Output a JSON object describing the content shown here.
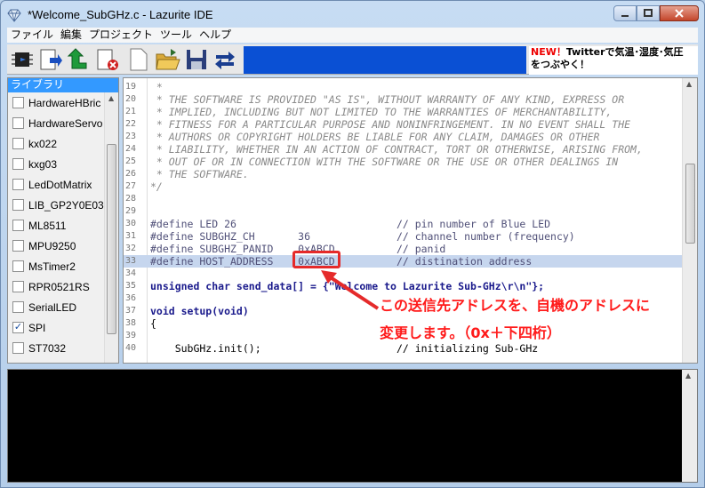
{
  "window": {
    "title": "*Welcome_SubGHz.c - Lazurite IDE"
  },
  "menu": [
    "ファイル",
    "編集",
    "プロジェクト",
    "ツール",
    "ヘルプ"
  ],
  "news": {
    "badge": "NEW！",
    "line1": "Twitterで気温･湿度･気圧",
    "line2": "をつぶやく！"
  },
  "library": {
    "header": "ライブラリ",
    "items": [
      {
        "label": "HardwareHBric",
        "checked": false
      },
      {
        "label": "HardwareServo",
        "checked": false
      },
      {
        "label": "kx022",
        "checked": false
      },
      {
        "label": "kxg03",
        "checked": false
      },
      {
        "label": "LedDotMatrix",
        "checked": false
      },
      {
        "label": "LIB_GP2Y0E03",
        "checked": false
      },
      {
        "label": "ML8511",
        "checked": false
      },
      {
        "label": "MPU9250",
        "checked": false
      },
      {
        "label": "MsTimer2",
        "checked": false
      },
      {
        "label": "RPR0521RS",
        "checked": false
      },
      {
        "label": "SerialLED",
        "checked": false
      },
      {
        "label": "SPI",
        "checked": true
      },
      {
        "label": "ST7032",
        "checked": false
      }
    ]
  },
  "editor": {
    "lines": [
      {
        "n": "19",
        "t": " *"
      },
      {
        "n": "20",
        "t": " * THE SOFTWARE IS PROVIDED \"AS IS\", WITHOUT WARRANTY OF ANY KIND, EXPRESS OR"
      },
      {
        "n": "21",
        "t": " * IMPLIED, INCLUDING BUT NOT LIMITED TO THE WARRANTIES OF MERCHANTABILITY,"
      },
      {
        "n": "22",
        "t": " * FITNESS FOR A PARTICULAR PURPOSE AND NONINFRINGEMENT. IN NO EVENT SHALL THE"
      },
      {
        "n": "23",
        "t": " * AUTHORS OR COPYRIGHT HOLDERS BE LIABLE FOR ANY CLAIM, DAMAGES OR OTHER"
      },
      {
        "n": "24",
        "t": " * LIABILITY, WHETHER IN AN ACTION OF CONTRACT, TORT OR OTHERWISE, ARISING FROM,"
      },
      {
        "n": "25",
        "t": " * OUT OF OR IN CONNECTION WITH THE SOFTWARE OR THE USE OR OTHER DEALINGS IN"
      },
      {
        "n": "26",
        "t": " * THE SOFTWARE."
      },
      {
        "n": "27",
        "t": "*/"
      },
      {
        "n": "28",
        "t": ""
      },
      {
        "n": "29",
        "t": ""
      },
      {
        "n": "30",
        "t": "#define LED 26                          // pin number of Blue LED"
      },
      {
        "n": "31",
        "t": "#define SUBGHZ_CH       36              // channel number (frequency)"
      },
      {
        "n": "32",
        "t": "#define SUBGHZ_PANID    0xABCD          // panid"
      },
      {
        "n": "33",
        "t": "#define HOST_ADDRESS    0xABCD          // distination address"
      },
      {
        "n": "34",
        "t": ""
      },
      {
        "n": "35",
        "t": "unsigned char send_data[] = {\"Welcome to Lazurite Sub-GHz\\r\\n\"};"
      },
      {
        "n": "36",
        "t": ""
      },
      {
        "n": "37",
        "t": "void setup(void)"
      },
      {
        "n": "38",
        "t": "{"
      },
      {
        "n": "39",
        "t": ""
      },
      {
        "n": "40",
        "t": "    SubGHz.init();                      // initializing Sub-GHz"
      }
    ]
  },
  "annotation": {
    "line1": "この送信先アドレスを、自機のアドレスに",
    "line2": "変更します。（0x＋下四桁）"
  }
}
